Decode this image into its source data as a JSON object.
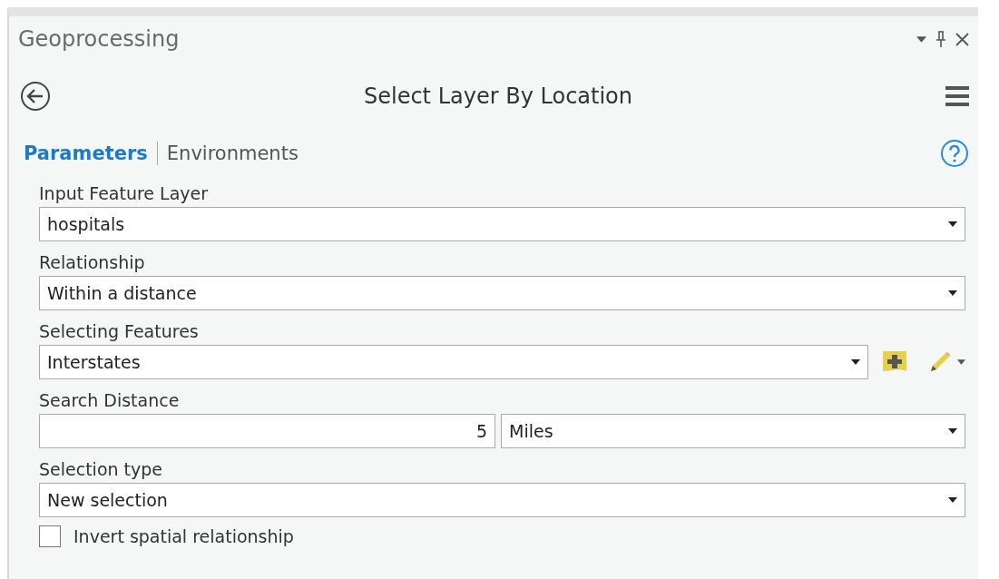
{
  "window": {
    "title": "Geoprocessing"
  },
  "tool": {
    "title": "Select Layer By Location"
  },
  "tabs": [
    {
      "label": "Parameters",
      "selected": true
    },
    {
      "label": "Environments",
      "selected": false
    }
  ],
  "parameters": [
    {
      "kind": "dropdown",
      "label": "Input Feature Layer",
      "value": "hospitals"
    },
    {
      "kind": "dropdown",
      "label": "Relationship",
      "value": "Within a distance"
    },
    {
      "kind": "dropdown-tools",
      "label": "Selecting Features",
      "value": "Interstates"
    },
    {
      "kind": "number-unit",
      "label": "Search Distance",
      "value": "5",
      "unit": "Miles"
    },
    {
      "kind": "dropdown",
      "label": "Selection type",
      "value": "New selection"
    },
    {
      "kind": "checkbox",
      "label": "Invert spatial relationship",
      "checked": false
    }
  ]
}
